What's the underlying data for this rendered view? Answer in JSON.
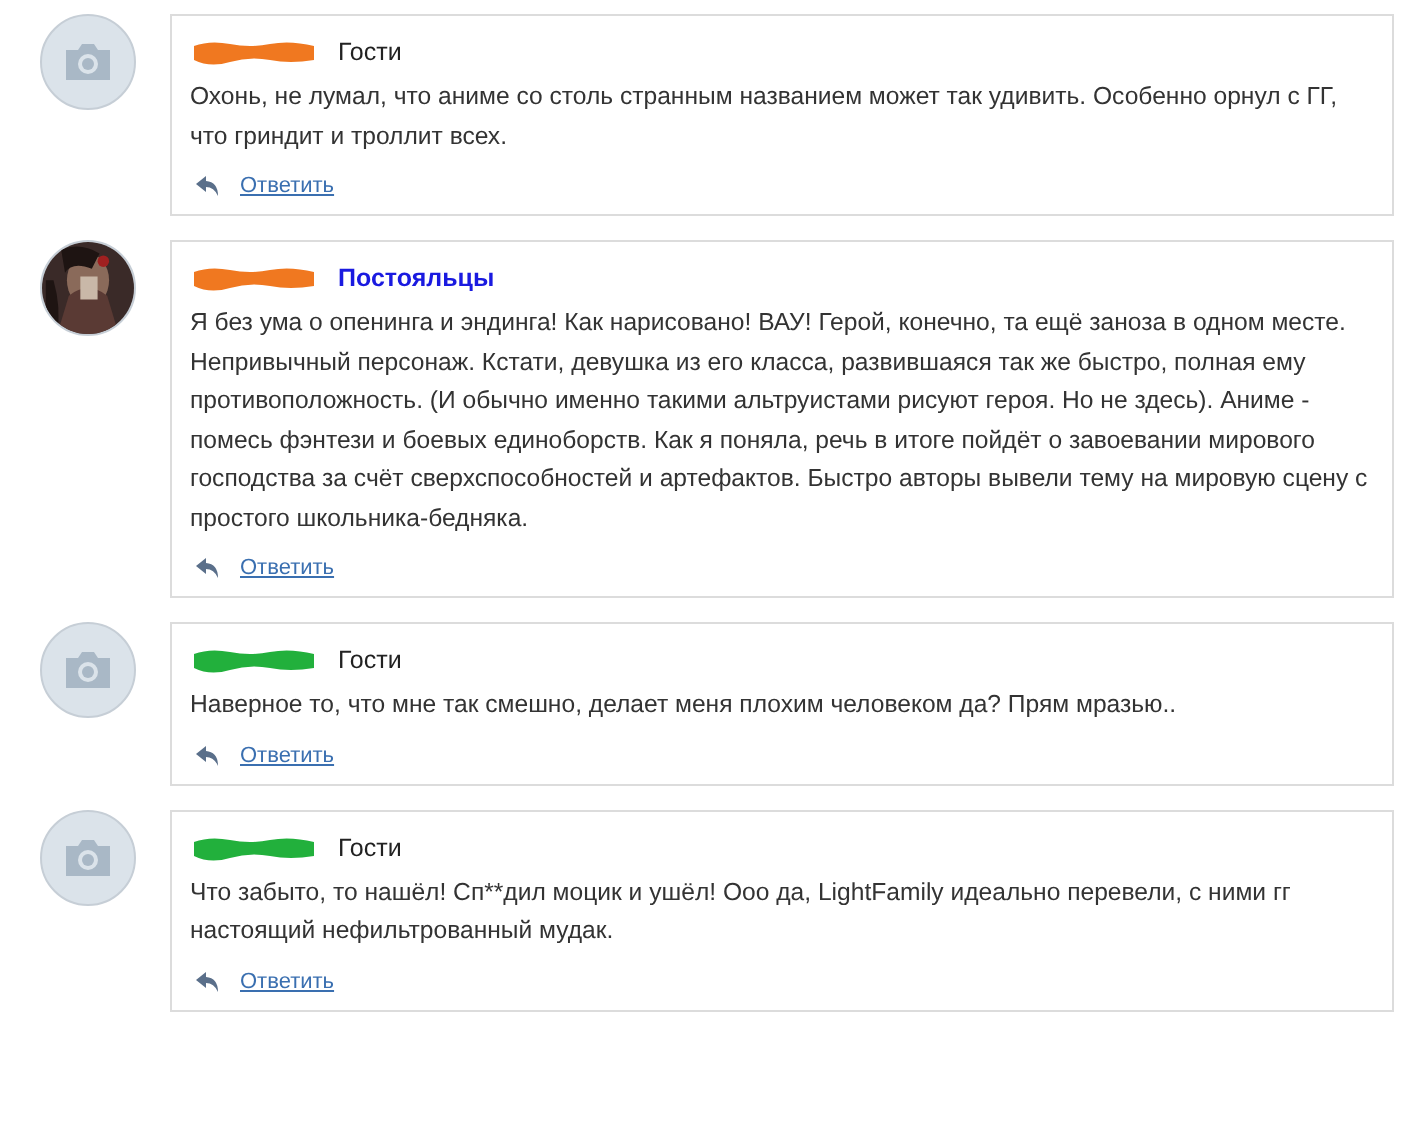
{
  "comments": [
    {
      "kind": "placeholder",
      "color": "#f07820",
      "group": {
        "label": "Гости",
        "kind": "guest"
      },
      "text": "Охонь, не лумал, что аниме со столь странным названием может так удивить. Особенно орнул с ГГ, что гриндит и троллит всех.",
      "reply": "Ответить"
    },
    {
      "kind": "picture",
      "color": "#f07820",
      "group": {
        "label": "Постояльцы",
        "kind": "regular"
      },
      "text": "Я без ума о опенинга и эндинга! Как нарисовано! ВАУ! Герой, конечно, та ещё заноза в одном месте. Непривычный персонаж. Кстати, девушка из его класса, развившаяся так же быстро, полная ему противоположность. (И обычно именно такими альтруистами рисуют героя. Но не здесь). Аниме - помесь фэнтези и боевых единоборств. Как я поняла, речь в итоге пойдёт о завоевании мирового господства за счёт сверхспособностей и артефактов. Быстро авторы вывели тему на мировую сцену с простого школьника-бедняка.",
      "reply": "Ответить"
    },
    {
      "kind": "placeholder",
      "color": "#22b03c",
      "group": {
        "label": "Гости",
        "kind": "guest"
      },
      "text": "Наверное то, что мне так смешно, делает меня плохим человеком да? Прям мразью..",
      "reply": "Ответить"
    },
    {
      "kind": "placeholder",
      "color": "#22b03c",
      "group": {
        "label": "Гости",
        "kind": "guest"
      },
      "text": "Что забыто, то нашёл! Сп**дил моцик и ушёл! Ооо да, LightFamily идеально перевели, с ними гг настоящий нефильтрованный мудак.",
      "reply": "Ответить"
    }
  ]
}
